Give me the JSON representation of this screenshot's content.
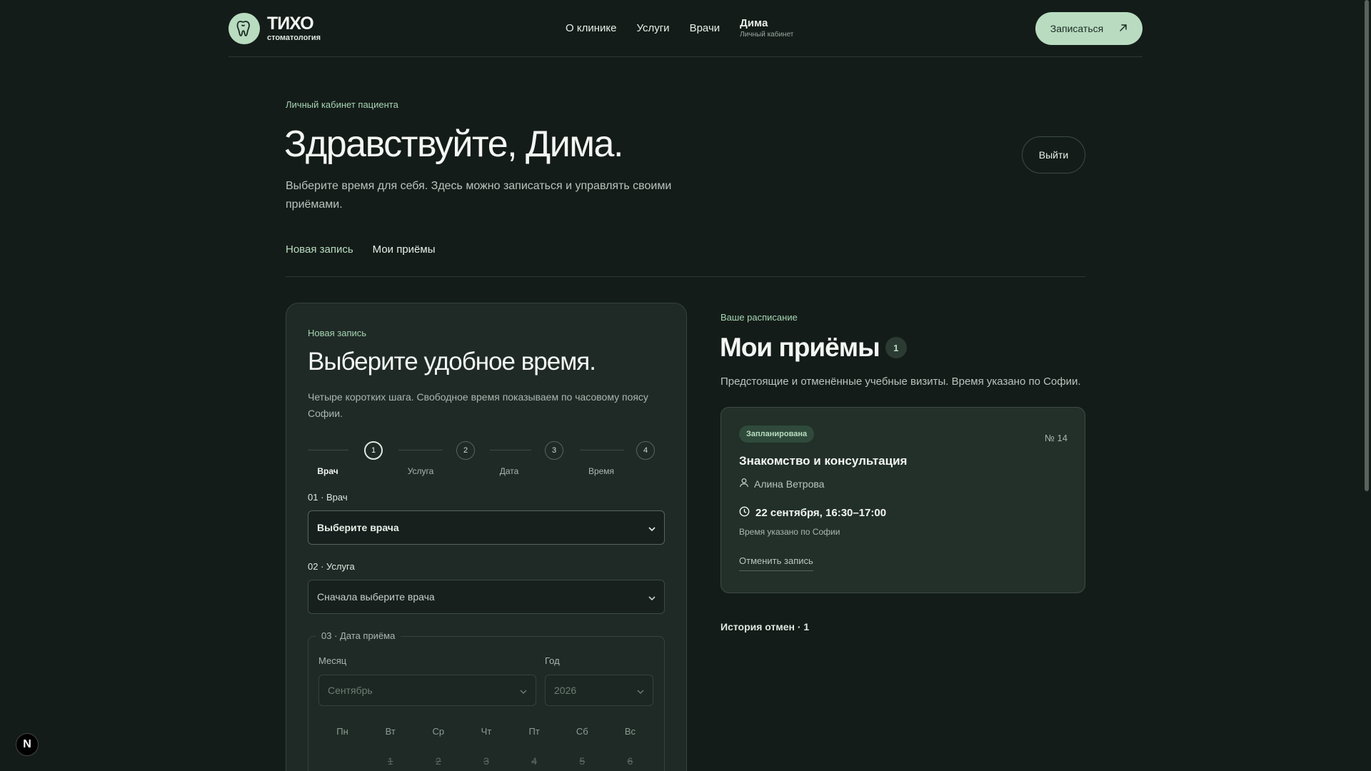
{
  "header": {
    "brand": "ТИХО",
    "brand_sub": "стоматология",
    "nav": [
      "О клинике",
      "Услуги",
      "Врачи"
    ],
    "user_name": "Дима",
    "user_sub": "Личный кабинет",
    "cta": "Записаться"
  },
  "hero": {
    "eyebrow": "Личный кабинет пациента",
    "title": "Здравствуйте, Дима.",
    "description": "Выберите время для себя. Здесь можно записаться и управлять своими приёмами.",
    "logout": "Выйти"
  },
  "tabs": [
    "Новая запись",
    "Мои приёмы"
  ],
  "booking": {
    "eyebrow": "Новая запись",
    "title": "Выберите удобное время.",
    "description": "Четыре коротких шага. Свободное время показываем по часовому поясу Софии.",
    "steps": [
      {
        "num": "1",
        "label": "Врач",
        "active": true
      },
      {
        "num": "2",
        "label": "Услуга",
        "active": false
      },
      {
        "num": "3",
        "label": "Дата",
        "active": false
      },
      {
        "num": "4",
        "label": "Время",
        "active": false
      }
    ],
    "doctor_label": "01 · Врач",
    "doctor_value": "Выберите врача",
    "service_label": "02 · Услуга",
    "service_value": "Сначала выберите врача",
    "date_legend": "03 · Дата приёма",
    "month_label": "Месяц",
    "month_value": "Сентябрь",
    "year_label": "Год",
    "year_value": "2026",
    "weekdays": [
      "Пн",
      "Вт",
      "Ср",
      "Чт",
      "Пт",
      "Сб",
      "Вс"
    ],
    "days": [
      "",
      "1",
      "2",
      "3",
      "4",
      "5",
      "6"
    ]
  },
  "schedule": {
    "eyebrow": "Ваше расписание",
    "title": "Мои приёмы",
    "count": "1",
    "description": "Предстоящие и отменённые учебные визиты. Время указано по Софии.",
    "appointment": {
      "status": "Запланирована",
      "number": "№ 14",
      "title": "Знакомство и консультация",
      "doctor": "Алина Ветрова",
      "datetime": "22 сентября, 16:30–17:00",
      "timezone": "Время указано по Софии",
      "cancel": "Отменить запись"
    },
    "cancel_history": "История отмен · 1"
  },
  "dev_badge": "N",
  "colors": {
    "background": "#141c19",
    "card": "#1f2a26",
    "accent": "#b9dcc1"
  }
}
